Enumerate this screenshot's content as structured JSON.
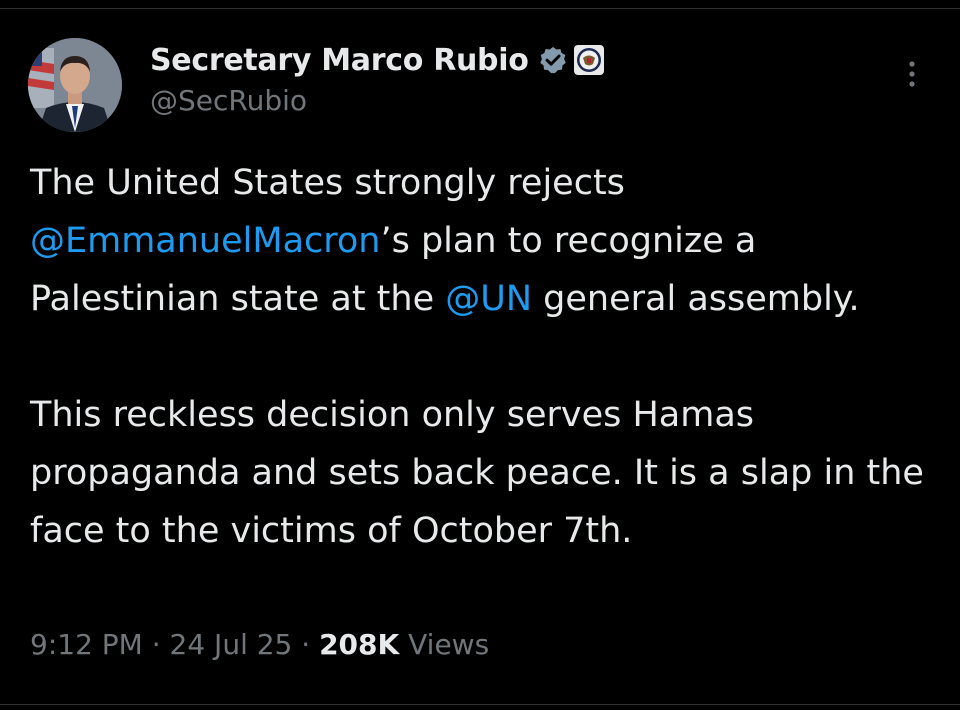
{
  "tweet": {
    "author": {
      "display_name": "Secretary Marco Rubio",
      "handle": "@SecRubio",
      "verified_icon": "verified-badge-icon",
      "affiliation_icon": "us-state-department-seal-icon"
    },
    "more_icon": "more-vertical-icon",
    "paragraph1": {
      "part1": "The United States strongly rejects ",
      "mention1": "@EmmanuelMacron",
      "part2": "’s plan to recognize a Palestinian state at the ",
      "mention2": "@UN",
      "part3": " general assembly."
    },
    "paragraph2": "This reckless decision only serves Hamas propaganda and sets back peace. It is a slap in the face to the victims of October 7th.",
    "meta": {
      "time": "9:12 PM",
      "separator": " · ",
      "date": "24 Jul 25",
      "views_count": "208K",
      "views_label": " Views"
    }
  },
  "colors": {
    "background": "#000000",
    "text": "#e7e9ea",
    "muted": "#71767b",
    "link": "#1d9bf0",
    "verified_badge": "#829aab"
  }
}
